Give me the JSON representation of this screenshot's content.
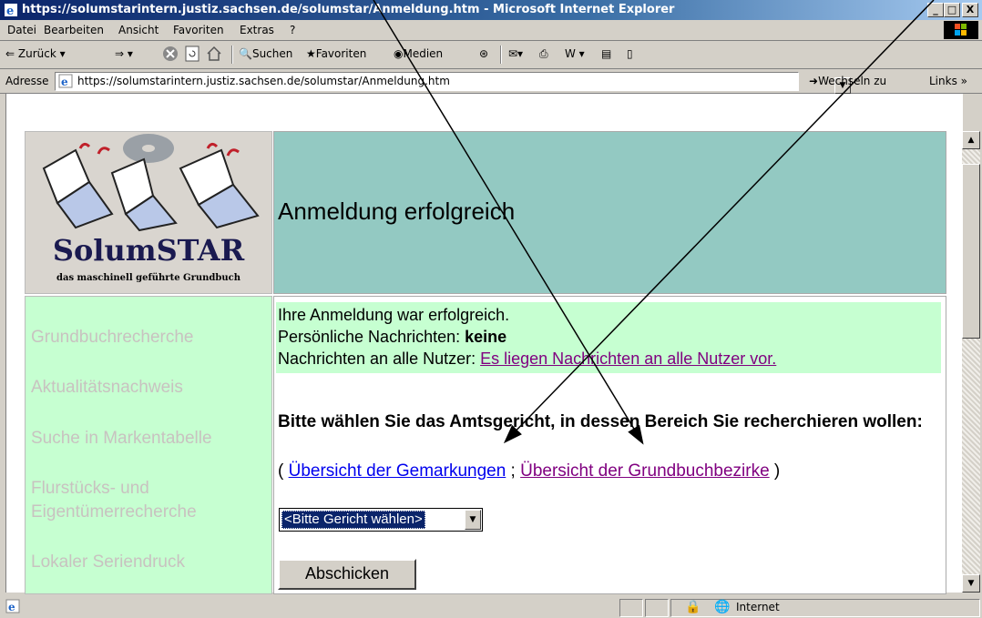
{
  "window": {
    "title": "https://solumstarintern.justiz.sachsen.de/solumstar/Anmeldung.htm - Microsoft Internet Explorer",
    "minimize": "_",
    "maximize": "□",
    "close": "X"
  },
  "menu": {
    "items": [
      "Datei",
      "Bearbeiten",
      "Ansicht",
      "Favoriten",
      "Extras",
      "?"
    ]
  },
  "toolbar": {
    "back": "Zurück",
    "search": "Suchen",
    "favorites": "Favoriten",
    "media": "Medien"
  },
  "address": {
    "label": "Adresse",
    "url": "https://solumstarintern.justiz.sachsen.de/solumstar/Anmeldung.htm",
    "go": "Wechseln zu",
    "links": "Links »"
  },
  "logo": {
    "name": "SolumSTAR",
    "tagline": "das maschinell geführte Grundbuch"
  },
  "header": {
    "title": "Anmeldung erfolgreich"
  },
  "nav": {
    "items": [
      "Grundbuchrecherche",
      "Aktualitätsnachweis",
      "Suche in Markentabelle",
      "Flurstücks- und",
      "Eigentümerrecherche",
      "Lokaler Seriendruck"
    ]
  },
  "main": {
    "success": "Ihre Anmeldung war erfolgreich.",
    "personal_label": "Persönliche Nachrichten: ",
    "personal_value": "keine",
    "all_label": "Nachrichten an alle Nutzer: ",
    "all_link": "Es liegen Nachrichten an alle Nutzer vor.",
    "prompt": "Bitte wählen Sie das Amtsgericht, in dessen Bereich Sie recherchieren wollen:",
    "open_paren": "( ",
    "link_gemarkungen": "Übersicht der Gemarkungen",
    "semicolon": " ; ",
    "link_bezirke": "Übersicht der Grundbuchbezirke",
    "close_paren": " )",
    "select_value": "<Bitte Gericht wählen>",
    "submit": "Abschicken"
  },
  "status": {
    "zone": "Internet"
  }
}
